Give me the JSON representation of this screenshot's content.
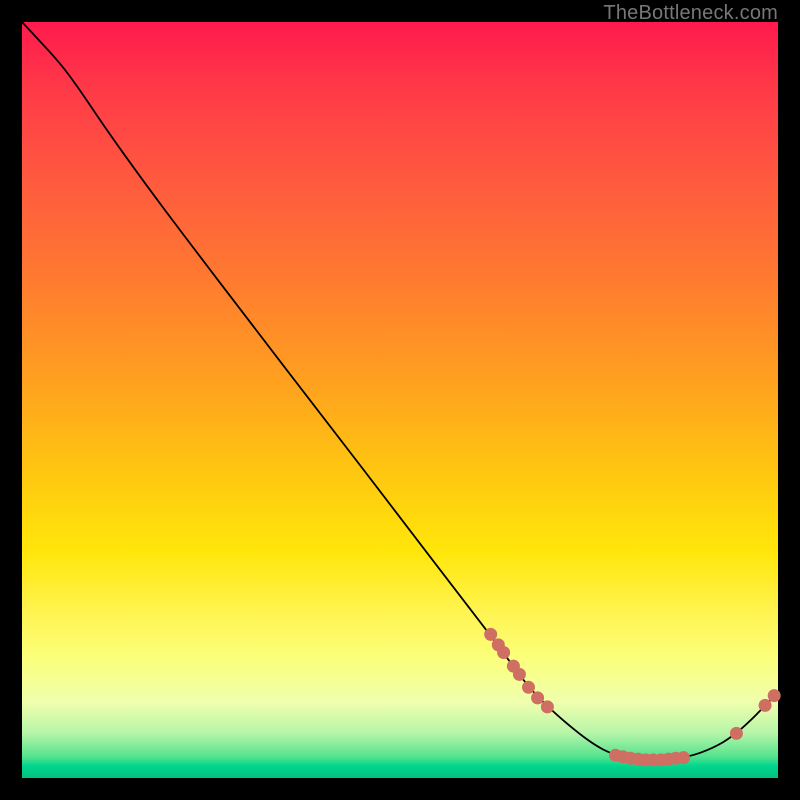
{
  "attribution": "TheBottleneck.com",
  "colors": {
    "dot": "#cf6e62",
    "curve": "#000000"
  },
  "chart_data": {
    "type": "line",
    "title": "",
    "xlabel": "",
    "ylabel": "",
    "xlim": [
      0,
      100
    ],
    "ylim": [
      0,
      100
    ],
    "grid": false,
    "legend": false,
    "note": "La forme est définie par des points (x,y) en pourcentage de la zone de tracé 756×756 (origine en haut à gauche). Les valeurs sont estimées à partir des pixels.",
    "curve_points": [
      {
        "x": 0.0,
        "y": 0.0
      },
      {
        "x": 3.0,
        "y": 3.2
      },
      {
        "x": 5.5,
        "y": 6.0
      },
      {
        "x": 8.0,
        "y": 9.5
      },
      {
        "x": 11.0,
        "y": 14.0
      },
      {
        "x": 16.0,
        "y": 21.0
      },
      {
        "x": 22.0,
        "y": 29.0
      },
      {
        "x": 30.0,
        "y": 39.5
      },
      {
        "x": 40.0,
        "y": 52.5
      },
      {
        "x": 50.0,
        "y": 65.5
      },
      {
        "x": 58.0,
        "y": 76.0
      },
      {
        "x": 63.0,
        "y": 82.5
      },
      {
        "x": 67.0,
        "y": 88.0
      },
      {
        "x": 70.0,
        "y": 91.0
      },
      {
        "x": 73.5,
        "y": 94.0
      },
      {
        "x": 76.0,
        "y": 95.8
      },
      {
        "x": 78.0,
        "y": 96.8
      },
      {
        "x": 80.5,
        "y": 97.4
      },
      {
        "x": 84.0,
        "y": 97.6
      },
      {
        "x": 88.0,
        "y": 97.3
      },
      {
        "x": 91.5,
        "y": 96.0
      },
      {
        "x": 94.0,
        "y": 94.5
      },
      {
        "x": 96.5,
        "y": 92.3
      },
      {
        "x": 98.5,
        "y": 90.2
      },
      {
        "x": 100.0,
        "y": 88.6
      }
    ],
    "dot_clusters": [
      {
        "x": 62.0,
        "y": 81.0
      },
      {
        "x": 63.0,
        "y": 82.4
      },
      {
        "x": 63.7,
        "y": 83.4
      },
      {
        "x": 65.0,
        "y": 85.2
      },
      {
        "x": 65.8,
        "y": 86.3
      },
      {
        "x": 67.0,
        "y": 88.0
      },
      {
        "x": 68.2,
        "y": 89.4
      },
      {
        "x": 69.5,
        "y": 90.6
      },
      {
        "x": 78.5,
        "y": 97.0
      },
      {
        "x": 79.5,
        "y": 97.2
      },
      {
        "x": 80.5,
        "y": 97.4
      },
      {
        "x": 81.5,
        "y": 97.5
      },
      {
        "x": 82.5,
        "y": 97.6
      },
      {
        "x": 83.5,
        "y": 97.6
      },
      {
        "x": 84.5,
        "y": 97.6
      },
      {
        "x": 85.5,
        "y": 97.5
      },
      {
        "x": 86.5,
        "y": 97.4
      },
      {
        "x": 87.5,
        "y": 97.3
      },
      {
        "x": 94.5,
        "y": 94.1
      },
      {
        "x": 98.3,
        "y": 90.4
      },
      {
        "x": 99.5,
        "y": 89.1
      }
    ],
    "dot_radius_px": 6
  }
}
